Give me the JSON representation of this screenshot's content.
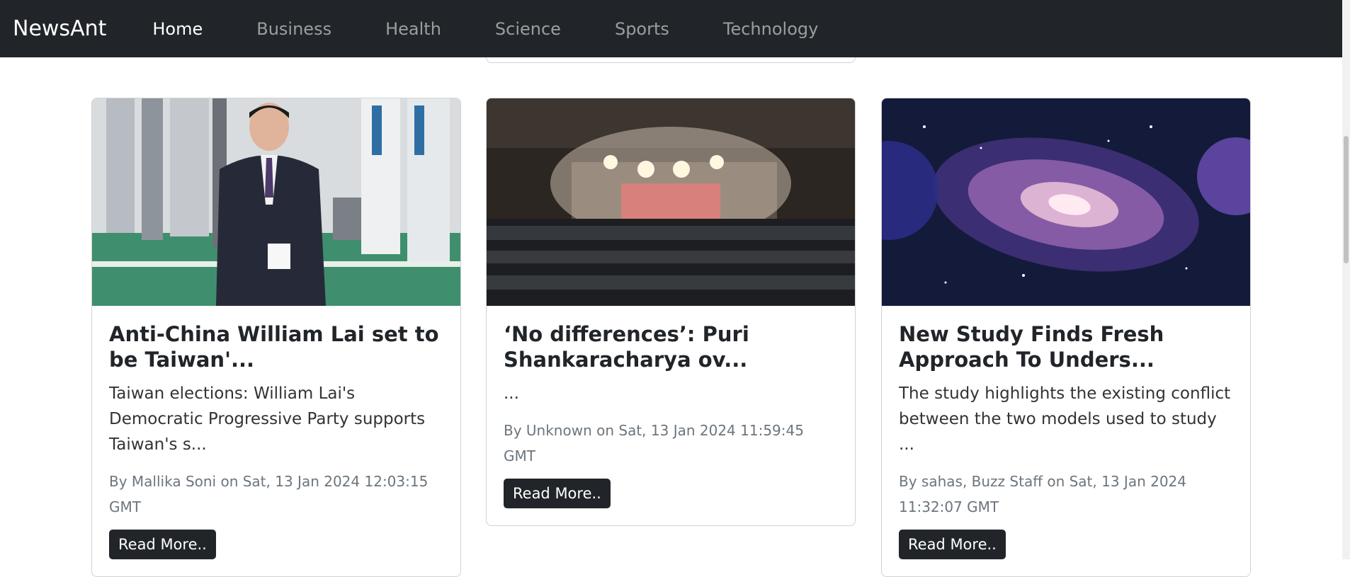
{
  "navbar": {
    "brand": "NewsAnt",
    "links": [
      "Home",
      "Business",
      "Health",
      "Science",
      "Sports",
      "Technology"
    ],
    "active": "Home"
  },
  "cards": [
    {
      "title": "Anti-China William Lai set to be Taiwan'...",
      "description": "Taiwan elections: William Lai's Democratic Progressive Party supports Taiwan's s...",
      "meta": "By Mallika Soni on Sat, 13 Jan 2024 12:03:15 GMT",
      "button": "Read More.."
    },
    {
      "title": "‘No differences’: Puri Shankaracharya ov...",
      "description": "...",
      "meta": "By Unknown on Sat, 13 Jan 2024 11:59:45 GMT",
      "button": "Read More.."
    },
    {
      "title": "New Study Finds Fresh Approach To Unders...",
      "description": "The study highlights the existing conflict between the two models used to study ...",
      "meta": "By sahas, Buzz Staff on Sat, 13 Jan 2024 11:32:07 GMT",
      "button": "Read More.."
    }
  ],
  "colors": {
    "navbar": "#212529",
    "button": "#212529",
    "meta_text": "#6c757d"
  }
}
